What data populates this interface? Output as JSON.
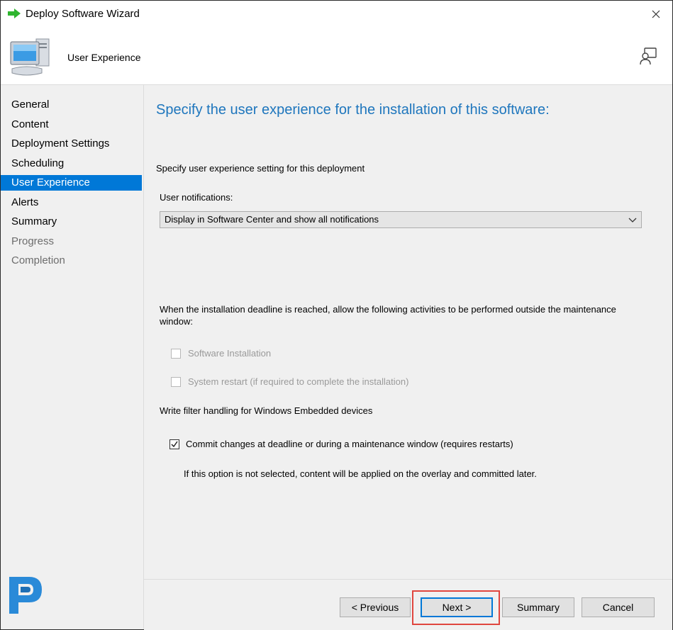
{
  "window": {
    "title": "Deploy Software Wizard",
    "close_icon": "close-icon",
    "arrow_icon": "green-arrow-icon"
  },
  "header": {
    "title": "User Experience",
    "icon": "computer-icon",
    "help_icon": "help-icon"
  },
  "sidebar": {
    "items": [
      {
        "label": "General",
        "state": "normal"
      },
      {
        "label": "Content",
        "state": "normal"
      },
      {
        "label": "Deployment Settings",
        "state": "normal"
      },
      {
        "label": "Scheduling",
        "state": "normal"
      },
      {
        "label": "User Experience",
        "state": "active"
      },
      {
        "label": "Alerts",
        "state": "normal"
      },
      {
        "label": "Summary",
        "state": "normal"
      },
      {
        "label": "Progress",
        "state": "disabled"
      },
      {
        "label": "Completion",
        "state": "disabled"
      }
    ],
    "logo_letter": "P"
  },
  "main": {
    "title": "Specify the user experience for the installation of this software:",
    "setting_label": "Specify user experience setting for this deployment",
    "notifications_label": "User notifications:",
    "notifications_value": "Display in Software Center and show all notifications",
    "deadline_text_1": "When the installation deadline is reached, allow the following activities to be performed outside the maintenance",
    "deadline_text_2": "window:",
    "software_installation": {
      "label": "Software Installation",
      "checked": false,
      "enabled": false
    },
    "system_restart": {
      "label": "System restart  (if required to complete the installation)",
      "checked": false,
      "enabled": false
    },
    "write_filter_label": "Write filter handling for Windows Embedded devices",
    "commit_changes": {
      "label": "Commit changes at deadline or during a maintenance window (requires restarts)",
      "checked": true,
      "enabled": true
    },
    "commit_note": "If this option is not selected, content will be applied on the overlay and committed later."
  },
  "footer": {
    "previous_label": "< Previous",
    "next_label": "Next >",
    "summary_label": "Summary",
    "cancel_label": "Cancel"
  },
  "colors": {
    "accent": "#0078d7",
    "title_blue": "#1e76bd",
    "highlight_red": "#e0463f",
    "panel_gray": "#f0f0f0"
  }
}
